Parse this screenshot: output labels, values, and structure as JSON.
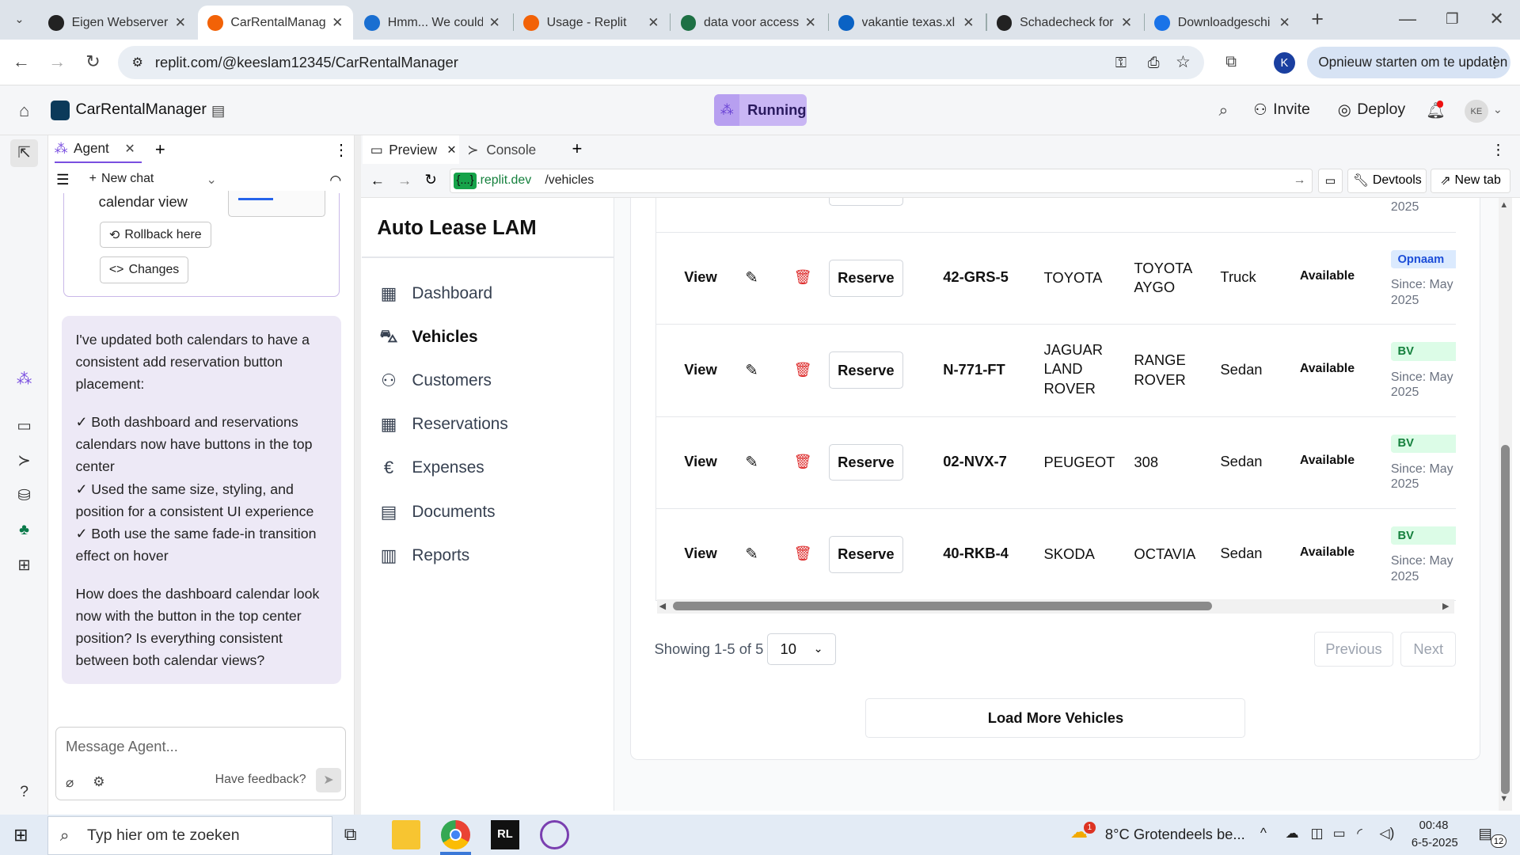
{
  "browser": {
    "tabs": [
      {
        "label": "Eigen Webserver",
        "icon": "github-icon"
      },
      {
        "label": "CarRentalManag",
        "icon": "replit-icon",
        "active": true
      },
      {
        "label": "Hmm... We could",
        "icon": "edge-icon"
      },
      {
        "label": "Usage - Replit",
        "icon": "replit-icon"
      },
      {
        "label": "data voor access",
        "icon": "excel-icon"
      },
      {
        "label": "vakantie texas.xl",
        "icon": "onedrive-icon"
      },
      {
        "label": "Schadecheck for",
        "icon": "openai-icon"
      },
      {
        "label": "Downloadgeschi",
        "icon": "download-icon"
      }
    ],
    "url": "replit.com/@keeslam12345/CarRentalManager",
    "update_label": "Opnieuw starten om te updaten",
    "profile_initial": "K"
  },
  "replit": {
    "project_name": "CarRentalManager",
    "run_status": "Running",
    "invite_label": "Invite",
    "deploy_label": "Deploy",
    "avatar_initials": "KE"
  },
  "agent": {
    "tab_label": "Agent",
    "new_chat_label": "New chat",
    "card_text": "calendar view",
    "rollback_label": "Rollback here",
    "changes_label": "Changes",
    "message_paragraphs": [
      "I've updated both calendars to have a consistent add reservation button placement:",
      "✓ Both dashboard and reservations calendars now have buttons in the top center\n✓ Used the same size, styling, and position for a consistent UI experience\n✓ Both use the same fade-in transition effect on hover",
      "How does the dashboard calendar look now with the button in the top center position? Is everything consistent between both calendar views?"
    ],
    "input_placeholder": "Message Agent...",
    "feedback_label": "Have feedback?"
  },
  "preview": {
    "tabs": [
      "Preview",
      "Console"
    ],
    "domain": ".replit.dev",
    "domain_badge": "{...}",
    "path": "/vehicles",
    "devtools_label": "Devtools",
    "newtab_label": "New tab"
  },
  "app": {
    "title": "Auto Lease LAM",
    "nav": [
      {
        "label": "Dashboard",
        "icon": "grid-icon"
      },
      {
        "label": "Vehicles",
        "icon": "car-icon",
        "active": true
      },
      {
        "label": "Customers",
        "icon": "users-icon"
      },
      {
        "label": "Reservations",
        "icon": "calendar-icon"
      },
      {
        "label": "Expenses",
        "icon": "euro-icon"
      },
      {
        "label": "Documents",
        "icon": "document-icon"
      },
      {
        "label": "Reports",
        "icon": "chart-icon"
      }
    ],
    "partial_row_since": "2025",
    "rows": [
      {
        "view": "View",
        "reserve": "Reserve",
        "plate": "42-GRS-5",
        "make": "TOYOTA",
        "model": "TOYOTA AYGO",
        "type": "Truck",
        "status": "Available",
        "badge": "Opnaam",
        "badge_color": "#1d4ed8",
        "badge_bg": "#dbeafe",
        "since": "Since: May 0 2025"
      },
      {
        "view": "View",
        "reserve": "Reserve",
        "plate": "N-771-FT",
        "make": "JAGUAR LAND ROVER",
        "model": "RANGE ROVER",
        "type": "Sedan",
        "status": "Available",
        "badge": "BV",
        "badge_color": "#15803d",
        "badge_bg": "#dcfce7",
        "since": "Since: May 0 2025"
      },
      {
        "view": "View",
        "reserve": "Reserve",
        "plate": "02-NVX-7",
        "make": "PEUGEOT",
        "model": "308",
        "type": "Sedan",
        "status": "Available",
        "badge": "BV",
        "badge_color": "#15803d",
        "badge_bg": "#dcfce7",
        "since": "Since: May 0 2025"
      },
      {
        "view": "View",
        "reserve": "Reserve",
        "plate": "40-RKB-4",
        "make": "SKODA",
        "model": "OCTAVIA",
        "type": "Sedan",
        "status": "Available",
        "badge": "BV",
        "badge_color": "#15803d",
        "badge_bg": "#dcfce7",
        "since": "Since: May 0 2025"
      }
    ],
    "showing_text": "Showing 1-5 of 5",
    "page_size": "10",
    "previous_label": "Previous",
    "next_label": "Next",
    "load_more_label": "Load More Vehicles"
  },
  "taskbar": {
    "search_placeholder": "Typ hier om te zoeken",
    "weather": "8°C  Grotendeels be...",
    "weather_badge": "1",
    "time": "00:48",
    "date": "6-5-2025",
    "notification_count": "12"
  }
}
